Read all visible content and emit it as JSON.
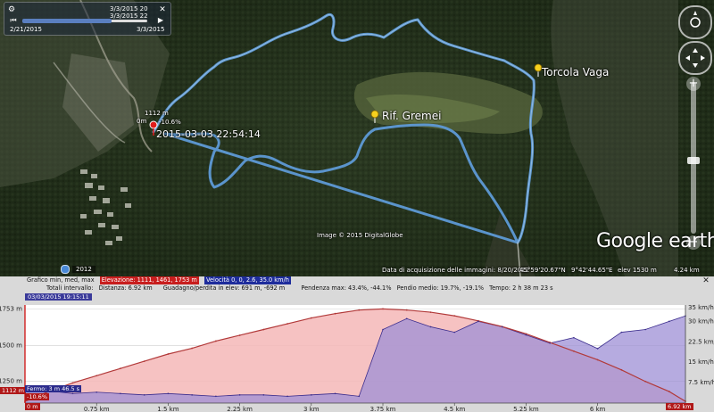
{
  "map": {
    "placemarks": [
      {
        "label": "Torcola Vaga",
        "color": "#f7d11e"
      },
      {
        "label": "Rif. Gremei",
        "color": "#f7d11e"
      }
    ],
    "current_point": {
      "elev_label": "1112 m",
      "dist_label": "0m",
      "grade_label": "-10.6%",
      "timestamp": "2015-03-03 22:54:14"
    },
    "image_credit": "Image © 2015 DigitalGlobe",
    "logo_text": "Google earth",
    "year_badge": "2012",
    "status": {
      "acquisition": "Data di acquisizione delle immagini: 8/20/2012",
      "lat": "45°59'20.67\"N",
      "lon": "9°42'44.65\"E",
      "elev": "elev 1530 m",
      "eye_alt": "4.24 km"
    },
    "track_color": "#5e9ad6"
  },
  "timeslider": {
    "top_right_1": "3/3/2015  20",
    "top_right_2": "3/3/2015  22",
    "start_date": "2/21/2015",
    "end_date": "3/3/2015"
  },
  "panel": {
    "row1": {
      "prefix": "Grafico  min, med, max",
      "elevation": "Elevazione: 1111, 1461, 1753 m",
      "speed": "Velocità  0, 0, 2.6, 35.0 km/h"
    },
    "row2": {
      "interval": "Totali intervallo:",
      "distance": "Distanza: 6.92 km",
      "gain": "Guadagno/perdita in elev: 691 m, -692 m",
      "slope": "Pendenza max: 43.4%, -44.1%",
      "avg": "Pendio medio: 19.7%, -19.1%",
      "time": "Tempo: 2 h 38 m 23 s"
    },
    "date_tag": "03/03/2015 19:15:11",
    "cursor_elev": "1112 m",
    "cursor_grade": "-10.6%",
    "cursor_time": "Fermo: 3 m 46.5 s",
    "cursor_dist": "0 m",
    "end_dist": "6.92 km"
  },
  "chart_data": {
    "type": "area",
    "x_unit": "km",
    "x": [
      0,
      0.25,
      0.5,
      0.75,
      1.0,
      1.25,
      1.5,
      1.75,
      2.0,
      2.25,
      2.5,
      2.75,
      3.0,
      3.25,
      3.5,
      3.75,
      4.0,
      4.25,
      4.5,
      4.75,
      5.0,
      5.25,
      5.5,
      5.75,
      6.0,
      6.25,
      6.5,
      6.75,
      6.92
    ],
    "xlim": [
      0,
      6.92
    ],
    "x_ticks": [
      "0 m",
      "0.75 km",
      "1.5 km",
      "2.25 km",
      "3 km",
      "3.75 km",
      "4.5 km",
      "5.25 km",
      "6 km",
      "6.92 km"
    ],
    "series": [
      {
        "name": "Elevazione",
        "unit": "m",
        "color": "#b23a3a",
        "fill": "#f4b7b7",
        "values": [
          1112,
          1180,
          1240,
          1290,
          1340,
          1390,
          1440,
          1480,
          1530,
          1570,
          1610,
          1650,
          1690,
          1720,
          1745,
          1753,
          1745,
          1730,
          1705,
          1670,
          1630,
          1580,
          1520,
          1460,
          1400,
          1330,
          1250,
          1180,
          1112
        ]
      },
      {
        "name": "Velocità",
        "unit": "km/h",
        "color": "#3a2c8c",
        "fill": "#9d8fd6",
        "values": [
          4.5,
          4.5,
          3.5,
          4,
          3.5,
          3,
          3.5,
          3,
          2.5,
          3,
          3,
          2.5,
          3,
          3.5,
          2.5,
          27,
          31,
          28,
          26,
          30,
          28,
          25,
          22,
          24,
          20,
          26,
          27,
          30,
          32
        ]
      }
    ],
    "y_left": {
      "ticks": [
        "1250 m",
        "1500 m",
        "1753 m"
      ],
      "lim": [
        1100,
        1780
      ]
    },
    "y_right": {
      "ticks": [
        "7.5 km/h",
        "15 km/h",
        "22.5 km/h",
        "30 km/h",
        "35 km/h"
      ],
      "lim": [
        0,
        36
      ]
    }
  }
}
